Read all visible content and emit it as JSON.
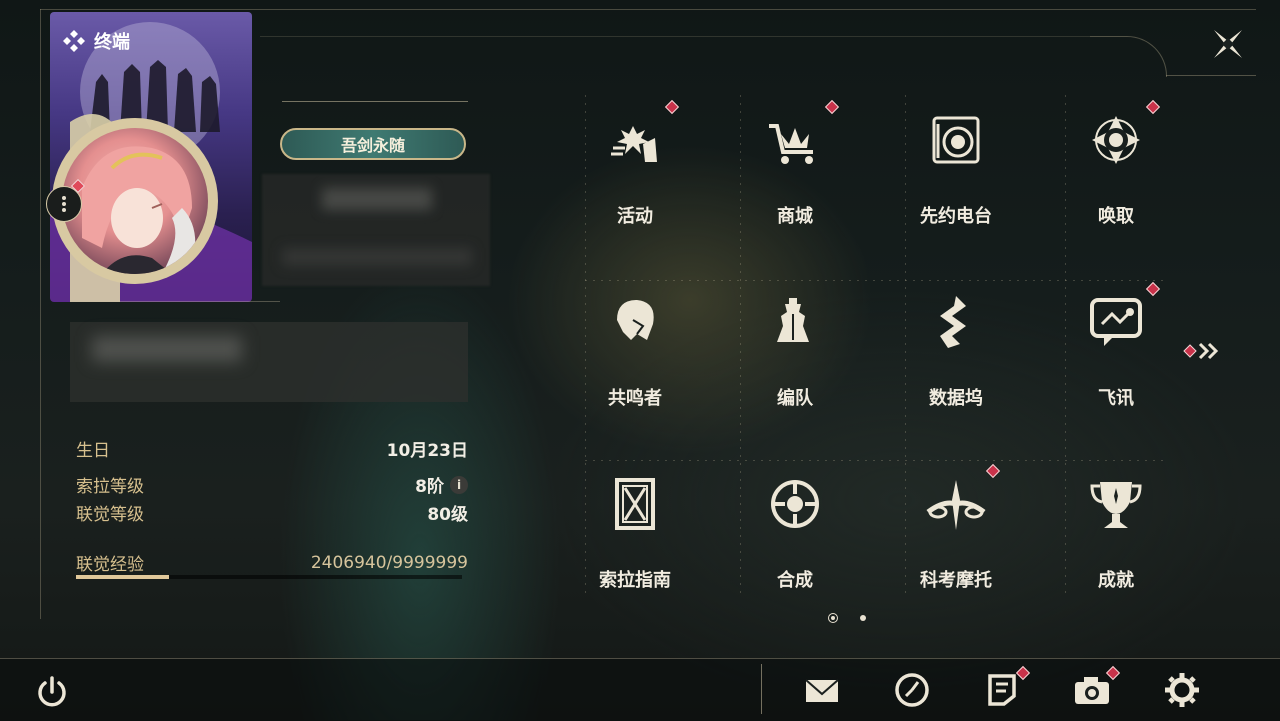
{
  "header": {
    "title": "终端"
  },
  "profile": {
    "title_badge": "吾剑永随",
    "stats": [
      {
        "label": "生日",
        "value": "10月23日"
      },
      {
        "label": "索拉等级",
        "value": "8阶"
      },
      {
        "label": "联觉等级",
        "value": "80级"
      }
    ],
    "exp": {
      "label": "联觉经验",
      "value": "2406940/9999999",
      "progress": 0.2407
    }
  },
  "menu": {
    "page_index": 1,
    "page_count": 2,
    "items": [
      {
        "label": "活动",
        "icon": "events-icon",
        "badge": true
      },
      {
        "label": "商城",
        "icon": "shop-cart-icon",
        "badge": true
      },
      {
        "label": "先约电台",
        "icon": "radio-icon",
        "badge": false
      },
      {
        "label": "唤取",
        "icon": "convene-icon",
        "badge": true
      },
      {
        "label": "共鸣者",
        "icon": "resonator-icon",
        "badge": false
      },
      {
        "label": "编队",
        "icon": "team-icon",
        "badge": false
      },
      {
        "label": "数据坞",
        "icon": "data-bank-icon",
        "badge": false
      },
      {
        "label": "飞讯",
        "icon": "message-icon",
        "badge": true
      },
      {
        "label": "索拉指南",
        "icon": "guidebook-icon",
        "badge": false
      },
      {
        "label": "合成",
        "icon": "synthesis-icon",
        "badge": false
      },
      {
        "label": "科考摩托",
        "icon": "motorcycle-icon",
        "badge": true
      },
      {
        "label": "成就",
        "icon": "trophy-icon",
        "badge": false
      }
    ]
  },
  "bottom_bar": {
    "items": [
      {
        "icon": "mail-icon",
        "badge": false
      },
      {
        "icon": "clock-icon",
        "badge": false
      },
      {
        "icon": "notice-icon",
        "badge": true
      },
      {
        "icon": "camera-icon",
        "badge": true
      },
      {
        "icon": "settings-icon",
        "badge": false
      }
    ]
  },
  "colors": {
    "accent_gold": "#d7c08e",
    "badge_red": "#c9324a"
  }
}
